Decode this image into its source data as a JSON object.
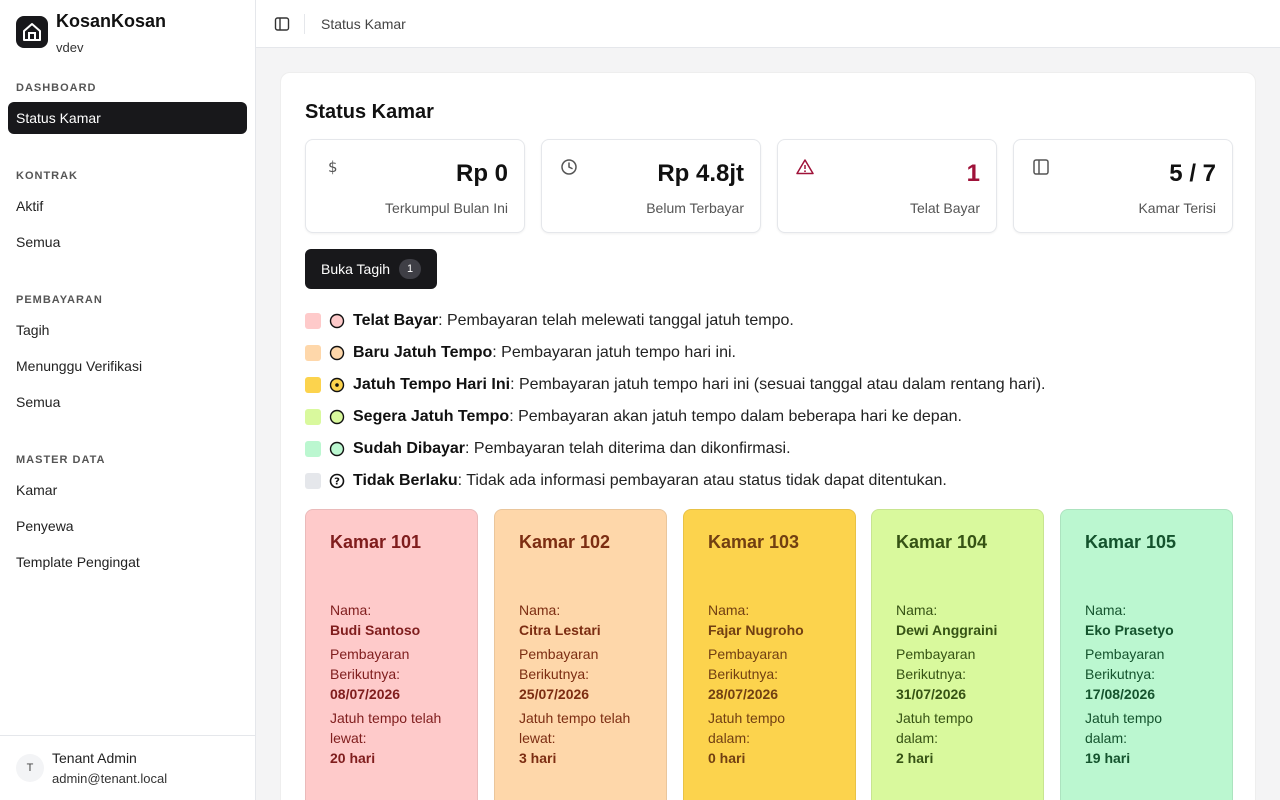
{
  "app": {
    "name": "KosanKosan",
    "subtitle": "vdev"
  },
  "sidebar": {
    "sections": [
      {
        "label": "DASHBOARD",
        "items": [
          "Status Kamar"
        ]
      },
      {
        "label": "KONTRAK",
        "items": [
          "Aktif",
          "Semua"
        ]
      },
      {
        "label": "PEMBAYARAN",
        "items": [
          "Tagih",
          "Menunggu Verifikasi",
          "Semua"
        ]
      },
      {
        "label": "MASTER DATA",
        "items": [
          "Kamar",
          "Penyewa",
          "Template Pengingat"
        ]
      }
    ],
    "user": {
      "initial": "T",
      "name": "Tenant Admin",
      "email": "admin@tenant.local"
    }
  },
  "topbar": {
    "breadcrumb": "Status Kamar"
  },
  "page": {
    "title": "Status Kamar",
    "stats": [
      {
        "icon": "dollar-icon",
        "value": "Rp 0",
        "label": "Terkumpul Bulan Ini"
      },
      {
        "icon": "clock-icon",
        "value": "Rp 4.8jt",
        "label": "Belum Terbayar"
      },
      {
        "icon": "alert-triangle-icon",
        "value": "1",
        "label": "Telat Bayar",
        "color": "#9f1239"
      },
      {
        "icon": "door-icon",
        "value": "5 / 7",
        "label": "Kamar Terisi"
      }
    ],
    "open_button": {
      "label": "Buka Tagih",
      "count": "1"
    }
  },
  "legend": [
    {
      "title": "Telat Bayar",
      "desc": ": Pembayaran telah melewati tanggal jatuh tempo.",
      "color": "#fecaca",
      "icon": "circle-icon"
    },
    {
      "title": "Baru Jatuh Tempo",
      "desc": ": Pembayaran jatuh tempo hari ini.",
      "color": "#fed7aa",
      "icon": "circle-icon"
    },
    {
      "title": "Jatuh Tempo Hari Ini",
      "desc": ": Pembayaran jatuh tempo hari ini (sesuai tanggal atau dalam rentang hari).",
      "color": "#fcd34d",
      "icon": "dot-circle-icon"
    },
    {
      "title": "Segera Jatuh Tempo",
      "desc": ": Pembayaran akan jatuh tempo dalam beberapa hari ke depan.",
      "color": "#d9f99d",
      "icon": "circle-icon"
    },
    {
      "title": "Sudah Dibayar",
      "desc": ": Pembayaran telah diterima dan dikonfirmasi.",
      "color": "#bbf7d0",
      "icon": "circle-icon"
    },
    {
      "title": "Tidak Berlaku",
      "desc": ": Tidak ada informasi pembayaran atau status tidak dapat ditentukan.",
      "color": "#e5e7eb",
      "icon": "question-circle-icon"
    }
  ],
  "rooms": [
    {
      "name": "Kamar 101",
      "label_name": "Nama:",
      "tenant": "Budi Santoso",
      "label_next1": "Pembayaran",
      "label_next2": "Berikutnya:",
      "next_date": "08/07/2026",
      "label_due1": "Jatuh tempo telah",
      "label_due2": "lewat:",
      "due": "20 hari",
      "bg": "#fecaca",
      "fg": "#7f1d1d"
    },
    {
      "name": "Kamar 102",
      "label_name": "Nama:",
      "tenant": "Citra Lestari",
      "label_next1": "Pembayaran",
      "label_next2": "Berikutnya:",
      "next_date": "25/07/2026",
      "label_due1": "Jatuh tempo telah",
      "label_due2": "lewat:",
      "due": "3 hari",
      "bg": "#fed7aa",
      "fg": "#7c2d12"
    },
    {
      "name": "Kamar 103",
      "label_name": "Nama:",
      "tenant": "Fajar Nugroho",
      "label_next1": "Pembayaran",
      "label_next2": "Berikutnya:",
      "next_date": "28/07/2026",
      "label_due1": "Jatuh tempo",
      "label_due2": "dalam:",
      "due": "0 hari",
      "bg": "#fcd34d",
      "fg": "#713f12"
    },
    {
      "name": "Kamar 104",
      "label_name": "Nama:",
      "tenant": "Dewi Anggraini",
      "label_next1": "Pembayaran",
      "label_next2": "Berikutnya:",
      "next_date": "31/07/2026",
      "label_due1": "Jatuh tempo",
      "label_due2": "dalam:",
      "due": "2 hari",
      "bg": "#d9f99d",
      "fg": "#365314"
    },
    {
      "name": "Kamar 105",
      "label_name": "Nama:",
      "tenant": "Eko Prasetyo",
      "label_next1": "Pembayaran",
      "label_next2": "Berikutnya:",
      "next_date": "17/08/2026",
      "label_due1": "Jatuh tempo",
      "label_due2": "dalam:",
      "due": "19 hari",
      "bg": "#bbf7d0",
      "fg": "#14532d"
    }
  ]
}
